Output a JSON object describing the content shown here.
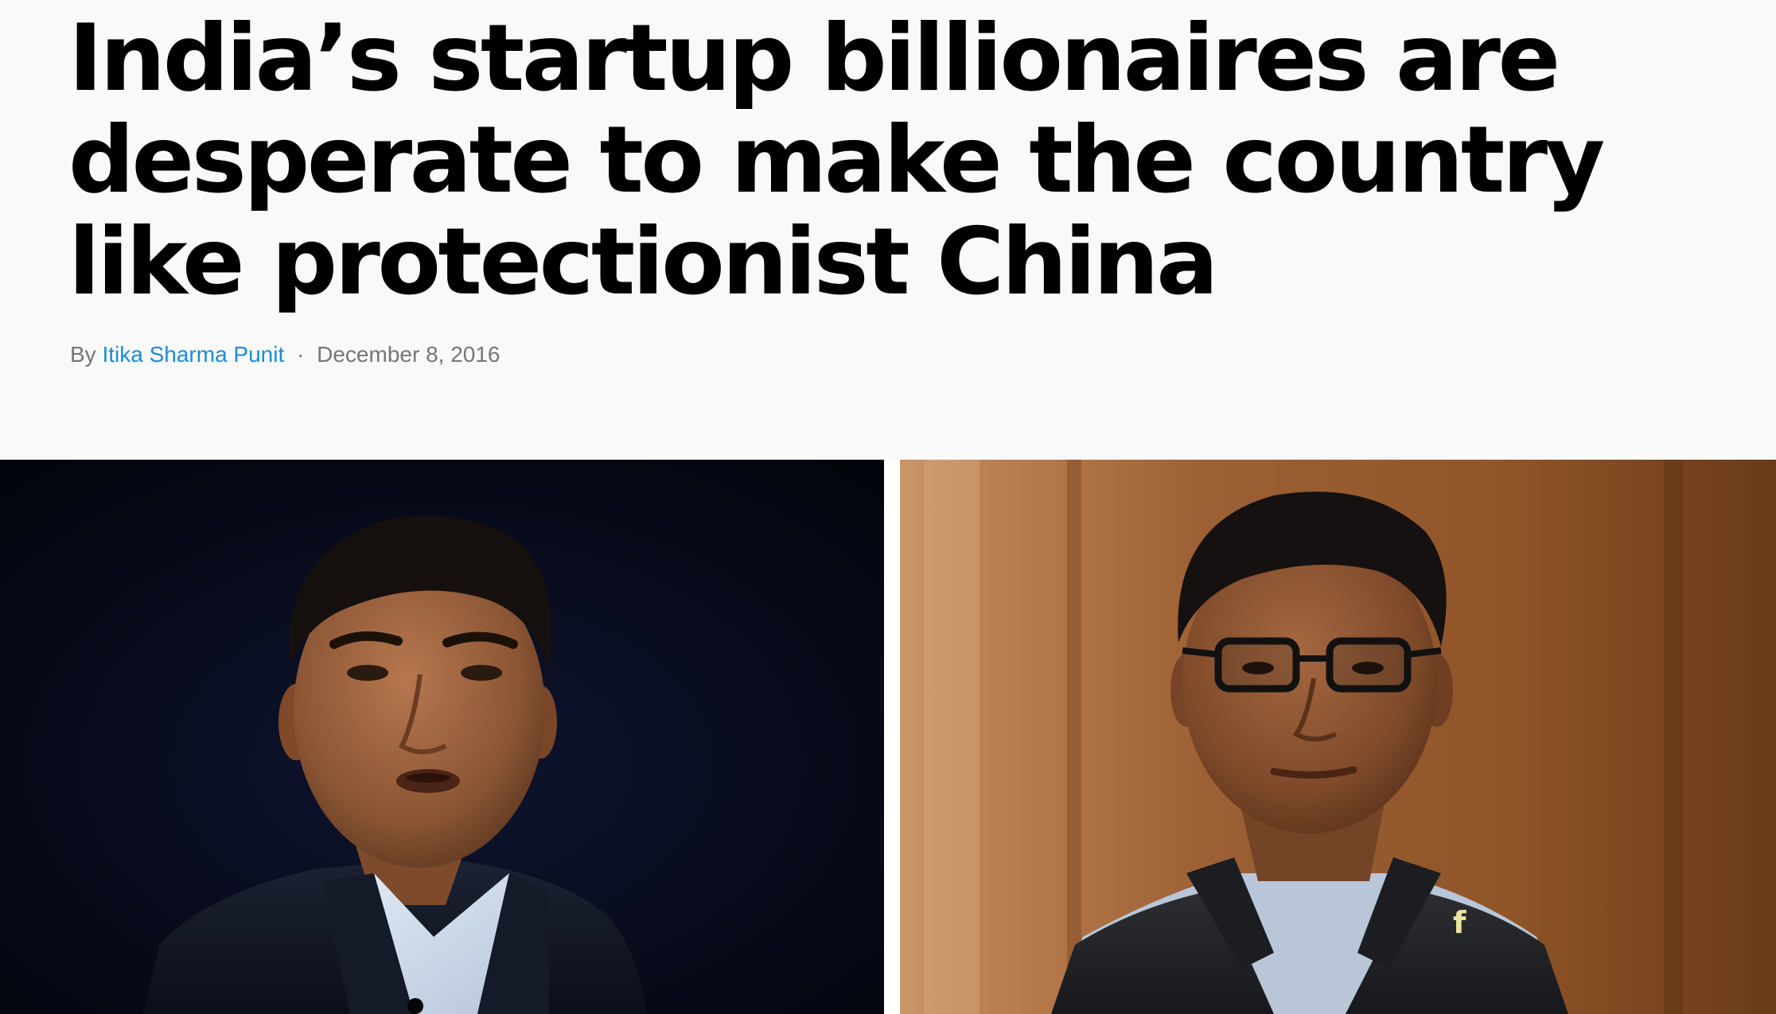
{
  "article": {
    "headline": "India’s startup billionaires are desperate to make the country like protectionist China",
    "byline": {
      "prefix": "By",
      "author": "Itika Sharma Punit",
      "separator": "·",
      "date": "December 8, 2016"
    }
  },
  "colors": {
    "page_background": "#f9f9f9",
    "headline": "#000000",
    "byline_text": "#767676",
    "author_link": "#1a8cd8"
  },
  "hero": {
    "left_photo": "man-in-dark-suit-on-stage-photo",
    "right_photo": "man-with-glasses-in-vest-photo"
  }
}
